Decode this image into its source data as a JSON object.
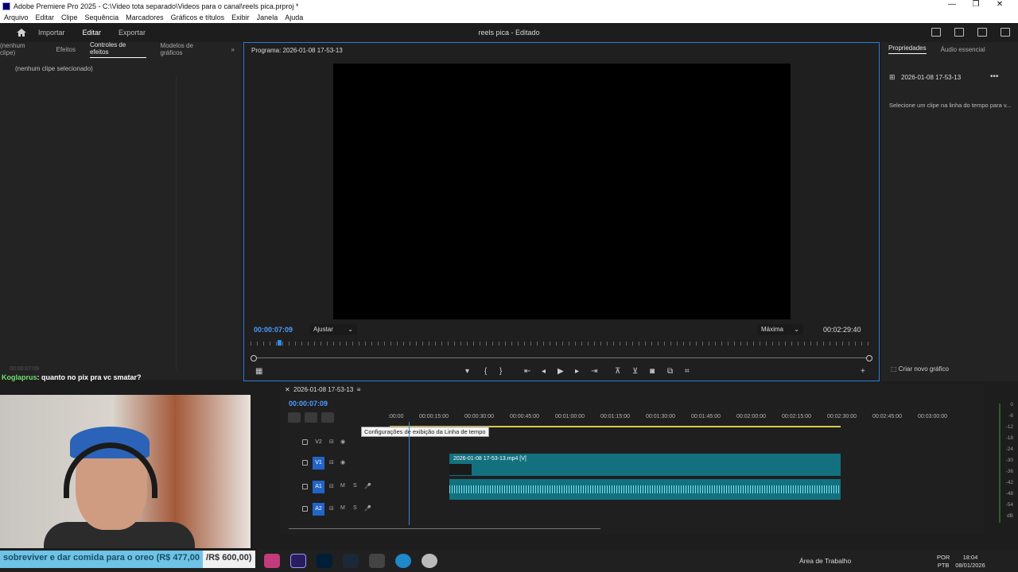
{
  "window": {
    "title": "Adobe Premiere Pro 2025 - C:\\Video tota separado\\Videos para o canal\\reels pica.prproj *",
    "controls": [
      "—",
      "❐",
      "✕"
    ]
  },
  "menu": [
    "Arquivo",
    "Editar",
    "Clipe",
    "Sequência",
    "Marcadores",
    "Gráficos e títulos",
    "Exibir",
    "Janela",
    "Ajuda"
  ],
  "workspace": {
    "tabs": [
      "Importar",
      "Editar",
      "Exportar"
    ],
    "active_tab": "Editar",
    "project_title": "reels pica - Editado"
  },
  "effects_panel": {
    "tabs": [
      "(nenhum clipe)",
      "Efeitos",
      "Controles de efeitos",
      "Modelos de gráficos"
    ],
    "active_tab": "Controles de efeitos",
    "no_clip": "(nenhum clipe selecionado)",
    "bottom_time": "00:00:07:09"
  },
  "program_monitor": {
    "title": "Programa: 2026-01-08 17-53-13",
    "timecode": "00:00:07:09",
    "fit": "Ajustar",
    "quality": "Máxima",
    "duration": "00:02:29:40"
  },
  "properties_panel": {
    "tabs": [
      "Propriedades",
      "Áudio essencial"
    ],
    "clip_name": "2026-01-08 17-53-13",
    "hint": "Selecione um clipe na linha do tempo para v...",
    "create_button": "Criar novo gráfico"
  },
  "timeline": {
    "sequence": "2026-01-08 17-53-13",
    "timecode": "00:00:07:09",
    "ruler": [
      ":00:00",
      "00:00:15:00",
      "00:00:30:00",
      "00:00:45:00",
      "00:01:00:00",
      "00:01:15:00",
      "00:01:30:00",
      "00:01:45:00",
      "00:02:00:00",
      "00:02:15:00",
      "00:02:30:00",
      "00:02:45:00",
      "00:03:00:00"
    ],
    "tooltip": "Configurações de exibição da Linha de tempo",
    "tracks": [
      "V2",
      "V1",
      "A1",
      "A2"
    ],
    "video_clip": "2026-01-08 17-53-13.mp4 [V]",
    "meter_scale": [
      "0",
      "-6",
      "-12",
      "-18",
      "-24",
      "-30",
      "-36",
      "-42",
      "-48",
      "-54",
      "dB"
    ]
  },
  "overlay": {
    "chat_nick": "Koglaprus",
    "chat_msg": ": quanto no pix pra vc smatar?",
    "donation_text": "sobreviver e dar comida para o oreo (R$ 477,00",
    "donation_goal": "/R$ 600,00)"
  },
  "taskbar": {
    "desktop": "Área de Trabalho",
    "lang1": "POR",
    "lang2": "PTB",
    "time": "18:04",
    "date": "08/01/2026"
  }
}
